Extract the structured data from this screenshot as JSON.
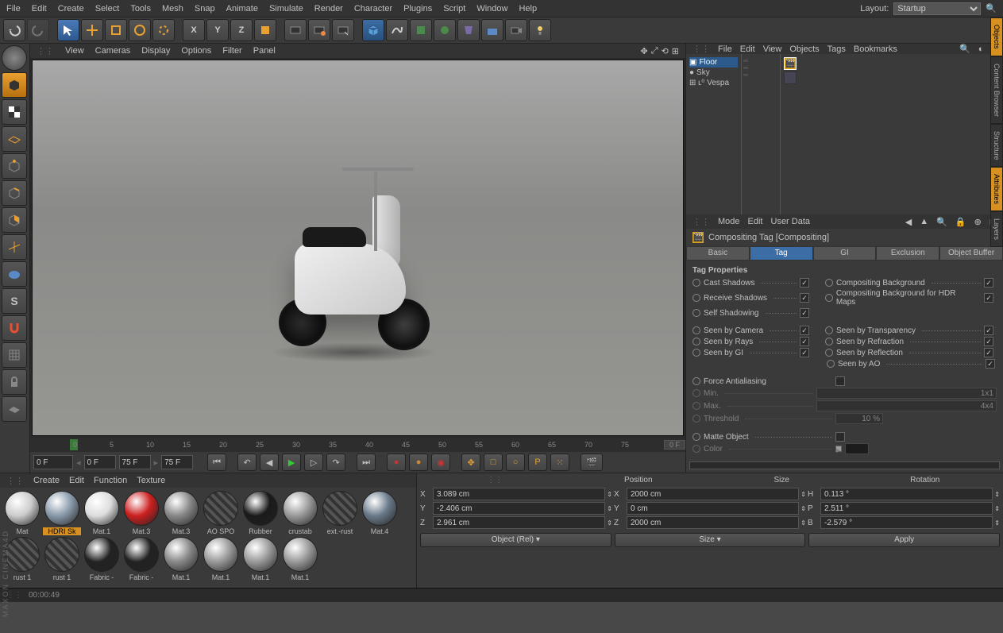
{
  "menubar": [
    "File",
    "Edit",
    "Create",
    "Select",
    "Tools",
    "Mesh",
    "Snap",
    "Animate",
    "Simulate",
    "Render",
    "Character",
    "Plugins",
    "Script",
    "Window",
    "Help"
  ],
  "layout": {
    "label": "Layout:",
    "value": "Startup"
  },
  "viewport_menu": [
    "View",
    "Cameras",
    "Display",
    "Options",
    "Filter",
    "Panel"
  ],
  "timeline": {
    "frames": [
      "0",
      "5",
      "10",
      "15",
      "20",
      "25",
      "30",
      "35",
      "40",
      "45",
      "50",
      "55",
      "60",
      "65",
      "70",
      "75"
    ],
    "end": "0 F"
  },
  "transport": {
    "cur": "0 F",
    "rangeA": "0 F",
    "rangeB": "75 F",
    "rangeC": "75 F"
  },
  "objects_menu": [
    "File",
    "Edit",
    "View",
    "Objects",
    "Tags",
    "Bookmarks"
  ],
  "tree": [
    {
      "name": "Floor",
      "sel": true
    },
    {
      "name": "Sky"
    },
    {
      "name": "Vespa"
    }
  ],
  "attr_menu": [
    "Mode",
    "Edit",
    "User Data"
  ],
  "attr_title": "Compositing Tag [Compositing]",
  "attr_tabs": [
    "Basic",
    "Tag",
    "GI",
    "Exclusion",
    "Object Buffer"
  ],
  "tag_section": "Tag Properties",
  "props_left1": [
    {
      "l": "Cast Shadows",
      "c": true
    },
    {
      "l": "Receive Shadows",
      "c": true
    },
    {
      "l": "Self Shadowing",
      "c": true
    }
  ],
  "props_right1": [
    {
      "l": "Compositing Background",
      "c": true
    },
    {
      "l": "Compositing Background for HDR Maps",
      "c": true
    }
  ],
  "props_left2": [
    {
      "l": "Seen by Camera",
      "c": true
    },
    {
      "l": "Seen by Rays",
      "c": true
    },
    {
      "l": "Seen by GI",
      "c": true
    }
  ],
  "props_right2": [
    {
      "l": "Seen by Transparency",
      "c": true
    },
    {
      "l": "Seen by Refraction",
      "c": true
    },
    {
      "l": "Seen by Reflection",
      "c": true
    },
    {
      "l": "Seen by AO",
      "c": true
    }
  ],
  "force_aa": "Force Antialiasing",
  "aa_min_l": "Min.",
  "aa_min_v": "1x1",
  "aa_max_l": "Max.",
  "aa_max_v": "4x4",
  "aa_thr_l": "Threshold",
  "aa_thr_v": "10 %",
  "matte_l": "Matte Object",
  "color_l": "Color",
  "mat_menu": [
    "Create",
    "Edit",
    "Function",
    "Texture"
  ],
  "materials_row1": [
    {
      "l": "Mat",
      "c": "#ccc"
    },
    {
      "l": "HDRI Sk",
      "c": "#8899aa",
      "sel": true
    },
    {
      "l": "Mat.1",
      "c": "#ddd"
    },
    {
      "l": "Mat.3",
      "c": "#cc2020"
    },
    {
      "l": "Mat.3",
      "c": "#888"
    },
    {
      "l": "AO SPO",
      "c": "#555",
      "stripe": true
    },
    {
      "l": "Rubber",
      "c": "#1a1a1a"
    },
    {
      "l": "crustab",
      "c": "#999"
    },
    {
      "l": "ext.-rust",
      "c": "#666",
      "stripe": true
    }
  ],
  "materials_row2": [
    {
      "l": "Mat.4",
      "c": "#6a7a8a"
    },
    {
      "l": "rust 1",
      "c": "#555",
      "stripe": true
    },
    {
      "l": "rust 1",
      "c": "#555",
      "stripe": true
    },
    {
      "l": "Fabric -",
      "c": "#222"
    },
    {
      "l": "Fabric -",
      "c": "#222"
    },
    {
      "l": "Mat.1",
      "c": "#888"
    },
    {
      "l": "Mat.1",
      "c": "#999"
    },
    {
      "l": "Mat.1",
      "c": "#999"
    },
    {
      "l": "Mat.1",
      "c": "#999"
    }
  ],
  "coord": {
    "hdr": [
      "Position",
      "Size",
      "Rotation"
    ],
    "rows": [
      {
        "a": "X",
        "p": "3.089 cm",
        "al": "X",
        "s": "2000 cm",
        "rl": "H",
        "r": "0.113 °"
      },
      {
        "a": "Y",
        "p": "-2.406 cm",
        "al": "Y",
        "s": "0 cm",
        "rl": "P",
        "r": "2.511 °"
      },
      {
        "a": "Z",
        "p": "2.961 cm",
        "al": "Z",
        "s": "2000 cm",
        "rl": "B",
        "r": "-2.579 °"
      }
    ],
    "btn1": "Object (Rel)",
    "btn2": "Size",
    "btn3": "Apply"
  },
  "status": "00:00:49",
  "side_tabs": [
    "Objects",
    "Content Browser",
    "Structure",
    "Attributes",
    "Layers"
  ]
}
